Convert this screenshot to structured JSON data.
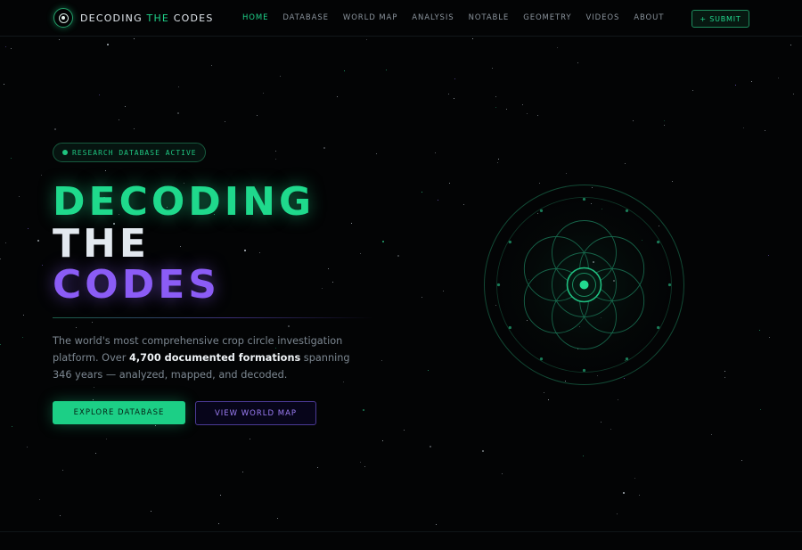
{
  "nav": {
    "brand_part1": "DECODING ",
    "brand_accent": "THE",
    "brand_part2": " CODES",
    "items": [
      {
        "label": "HOME",
        "active": true
      },
      {
        "label": "DATABASE",
        "active": false
      },
      {
        "label": "WORLD MAP",
        "active": false
      },
      {
        "label": "ANALYSIS",
        "active": false
      },
      {
        "label": "NOTABLE",
        "active": false
      },
      {
        "label": "GEOMETRY",
        "active": false
      },
      {
        "label": "VIDEOS",
        "active": false
      },
      {
        "label": "ABOUT",
        "active": false
      }
    ],
    "submit_label": "+ SUBMIT"
  },
  "hero": {
    "badge": "RESEARCH DATABASE ACTIVE",
    "title_line1": "DECODING",
    "title_line2": "THE",
    "title_line3": "CODES",
    "description_part1": "The world's most comprehensive crop circle investigation platform. Over ",
    "description_bold": "4,700 documented formations",
    "description_part2": " spanning 346 years — analyzed, mapped, and decoded.",
    "primary_button": "EXPLORE DATABASE",
    "secondary_button": "VIEW WORLD MAP"
  },
  "icons": {
    "logo": "crop-circle-logo-icon",
    "badge": "status-dot-icon",
    "hero_graphic": "flower-of-life-glyph"
  },
  "colors": {
    "accent_green": "#1fd98c",
    "accent_purple": "#8b5cf6",
    "background": "#030405",
    "text_light": "#e3e9ef",
    "text_muted": "#7c8791"
  }
}
